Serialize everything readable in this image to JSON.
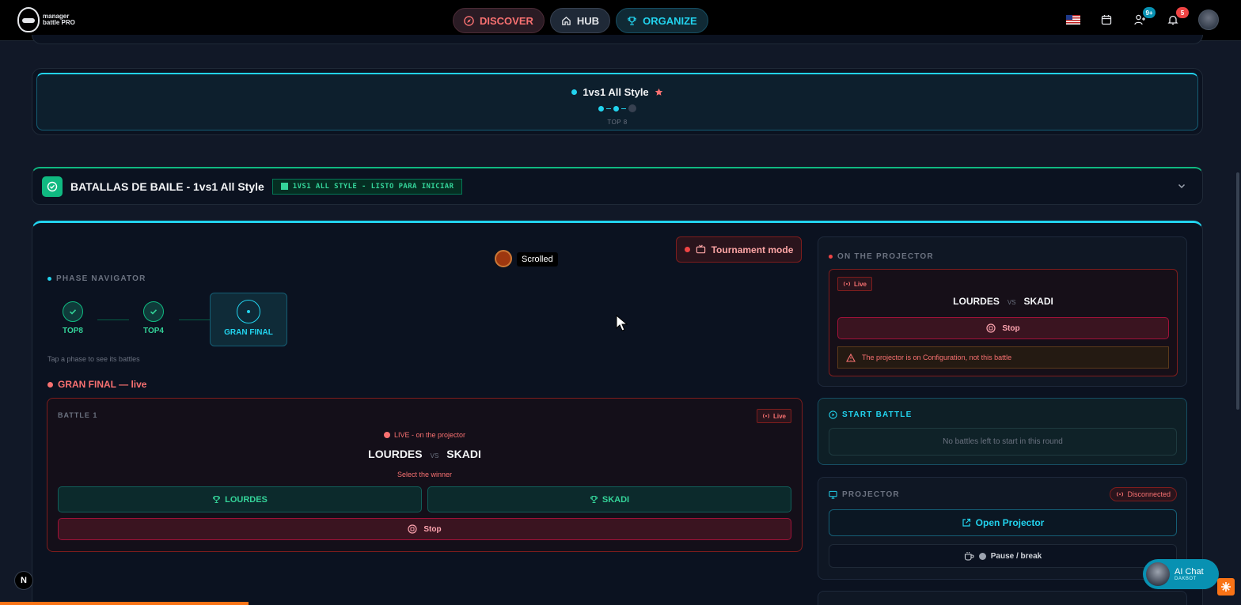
{
  "nav": {
    "logo_line1": "manager",
    "logo_line2": "battle PRO",
    "discover": "DISCOVER",
    "hub": "HUB",
    "organize": "ORGANIZE",
    "friends_badge": "9+",
    "notif_badge": "5"
  },
  "category_card": {
    "title": "1vs1 All Style",
    "phase": "TOP 8"
  },
  "section": {
    "title": "BATALLAS DE BAILE - 1vs1 All Style",
    "status": "1VS1 ALL STYLE - LISTO PARA INICIAR"
  },
  "overlay": {
    "scrolled": "Scrolled"
  },
  "left": {
    "tournament_mode": "Tournament mode",
    "phase_navigator_label": "PHASE NAVIGATOR",
    "phases": [
      {
        "name": "TOP8",
        "state": "done"
      },
      {
        "name": "TOP4",
        "state": "done"
      },
      {
        "name": "GRAN FINAL",
        "state": "active"
      }
    ],
    "tap_hint": "Tap a phase to see its battles",
    "live_heading": "GRAN FINAL — live",
    "battle": {
      "label": "BATTLE 1",
      "live_chip": "Live",
      "live_on_projector": "LIVE - on the projector",
      "dancer_a": "LOURDES",
      "vs": "VS",
      "dancer_b": "SKADI",
      "select_winner": "Select the winner",
      "winner_a": "LOURDES",
      "winner_b": "SKADI",
      "stop": "Stop"
    }
  },
  "right": {
    "on_projector": {
      "label": "ON THE PROJECTOR",
      "live_chip": "Live",
      "dancer_a": "LOURDES",
      "vs": "VS",
      "dancer_b": "SKADI",
      "stop": "Stop",
      "warning": "The projector is on Configuration, not this battle"
    },
    "start_battle": {
      "label": "START BATTLE",
      "empty": "No battles left to start in this round"
    },
    "projector": {
      "label": "PROJECTOR",
      "status": "Disconnected",
      "open": "Open Projector",
      "pause": "Pause / break"
    }
  },
  "ai_chat": {
    "title": "AI Chat",
    "subtitle": "DAKBOT"
  },
  "dev_badge": "N"
}
